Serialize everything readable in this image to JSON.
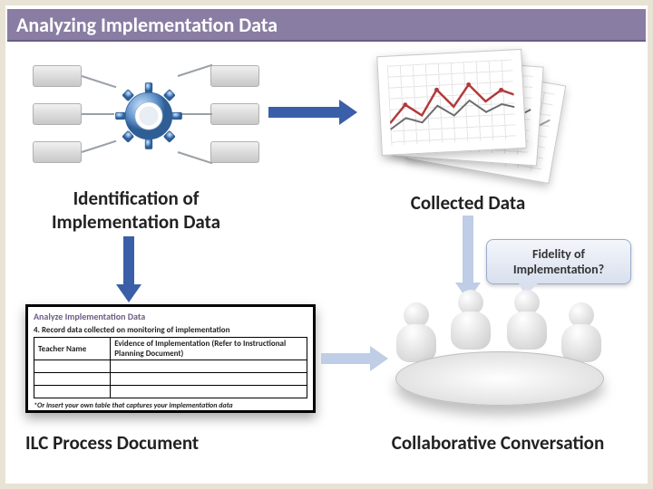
{
  "title": "Analyzing Implementation Data",
  "captions": {
    "top_left": "Identification of Implementation Data",
    "top_right": "Collected Data",
    "bottom_left": "ILC Process Document",
    "bottom_right": "Collaborative Conversation"
  },
  "bubble": "Fidelity of Implementation?",
  "doc": {
    "heading": "Analyze Implementation Data",
    "step": "4.   Record data collected on monitoring of implementation",
    "col1": "Teacher Name",
    "col2": "Evidence of Implementation (Refer to Instructional Planning Document)",
    "footnote": "*Or insert your own table that captures your implementation data"
  }
}
